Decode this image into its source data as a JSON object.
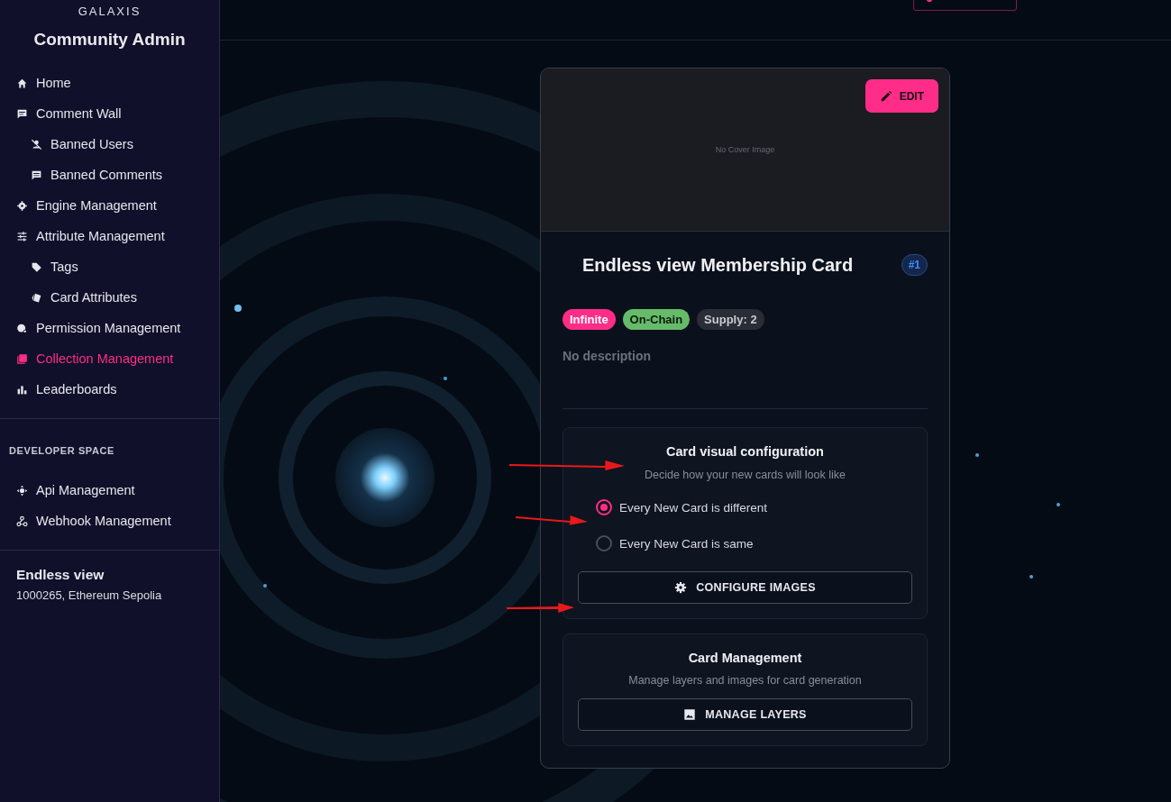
{
  "sidebar": {
    "logo": "GALAXIS",
    "title": "Community Admin",
    "nav": [
      {
        "label": "Home",
        "selected": false
      },
      {
        "label": "Comment Wall",
        "selected": false,
        "children": [
          {
            "label": "Banned Users",
            "selected": false
          },
          {
            "label": "Banned Comments",
            "selected": false
          }
        ]
      },
      {
        "label": "Engine Management",
        "selected": false
      },
      {
        "label": "Attribute Management",
        "selected": false,
        "children": [
          {
            "label": "Tags",
            "selected": false
          },
          {
            "label": "Card Attributes",
            "selected": false
          }
        ]
      },
      {
        "label": "Permission Management",
        "selected": false
      },
      {
        "label": "Collection Management",
        "selected": true
      },
      {
        "label": "Leaderboards",
        "selected": false
      }
    ],
    "section_heading": "DEVELOPER SPACE",
    "dev_nav": [
      {
        "label": "Api Management",
        "selected": false
      },
      {
        "label": "Webhook Management",
        "selected": false
      }
    ],
    "community": {
      "name": "Endless view",
      "details": "1000265, Ethereum Sepolia"
    }
  },
  "card": {
    "cover_note": "No Cover Image",
    "edit_button": "EDIT",
    "title": "Endless view Membership Card",
    "number": "#1",
    "tags": [
      {
        "label": "Infinite",
        "color": "#ff2d87"
      },
      {
        "label": "On-Chain",
        "color": "#66bb6a"
      },
      {
        "label": "Supply: 2",
        "color": "#2a2d36"
      }
    ],
    "description": "No description",
    "visual_config": {
      "title": "Card visual configuration",
      "subtitle": "Decide how your new cards will look like",
      "options": [
        {
          "label": "Every New Card is different",
          "selected": true
        },
        {
          "label": "Every New Card is same",
          "selected": false
        }
      ],
      "button": "CONFIGURE IMAGES"
    },
    "management": {
      "title": "Card Management",
      "subtitle": "Manage layers and images for card generation",
      "button": "MANAGE LAYERS"
    }
  }
}
